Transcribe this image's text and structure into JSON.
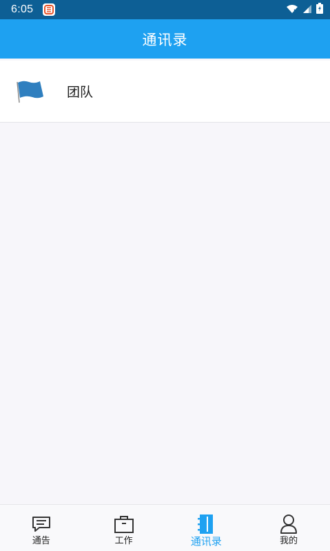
{
  "status_bar": {
    "time": "6:05",
    "notification_icon": "app-notification-icon",
    "icons": [
      "wifi-icon",
      "signal-icon",
      "battery-charging-icon"
    ],
    "background": "#0d5f95"
  },
  "app_bar": {
    "title": "通讯录",
    "background": "#1ea1f1"
  },
  "list": {
    "items": [
      {
        "label": "团队",
        "icon": "flag-icon"
      }
    ]
  },
  "tab_bar": {
    "active_index": 2,
    "active_color": "#1ea1f1",
    "tabs": [
      {
        "label": "通告",
        "icon": "message-icon"
      },
      {
        "label": "工作",
        "icon": "briefcase-icon"
      },
      {
        "label": "通讯录",
        "icon": "contacts-book-icon"
      },
      {
        "label": "我的",
        "icon": "person-icon"
      }
    ]
  }
}
